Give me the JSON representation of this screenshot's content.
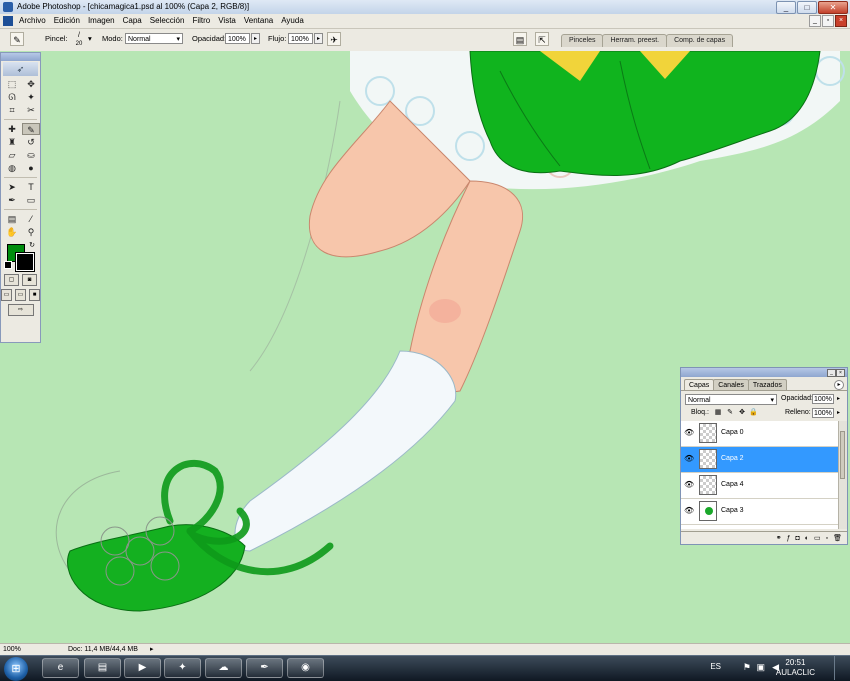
{
  "window": {
    "title": "Adobe Photoshop - [chicamagica1.psd al 100% (Capa 2, RGB/8)]",
    "buttons": [
      "_",
      "□",
      "✕"
    ]
  },
  "menu": [
    "Archivo",
    "Edición",
    "Imagen",
    "Capa",
    "Selección",
    "Filtro",
    "Vista",
    "Ventana",
    "Ayuda"
  ],
  "options": {
    "brush_label": "Pincel:",
    "brush_size": "20",
    "mode_label": "Modo:",
    "mode_value": "Normal",
    "opacity_label": "Opacidad:",
    "opacity_value": "100%",
    "flow_label": "Flujo:",
    "flow_value": "100%"
  },
  "palette_wells": [
    "Pinceles",
    "Herram. preest.",
    "Comp. de capas"
  ],
  "layers_panel": {
    "tabs": [
      "Capas",
      "Canales",
      "Trazados"
    ],
    "blend_mode": "Normal",
    "opacity_label": "Opacidad:",
    "opacity_value": "100%",
    "lock_label": "Bloq.:",
    "fill_label": "Relleno:",
    "fill_value": "100%",
    "layers": [
      {
        "name": "Capa 0",
        "active": false
      },
      {
        "name": "Capa 2",
        "active": true
      },
      {
        "name": "Capa 4",
        "active": false
      },
      {
        "name": "Capa 3",
        "active": false
      }
    ]
  },
  "status": {
    "zoom": "100%",
    "doc": "Doc: 11,4 MB/44,4 MB"
  },
  "taskbar": {
    "lang": "ES",
    "time": "20:51",
    "date": "AULACLIC"
  },
  "colors": {
    "canvas_bg": "#b7e6b4",
    "foreground": "#008c0e",
    "background": "#000000",
    "selection": "#3399ff"
  }
}
